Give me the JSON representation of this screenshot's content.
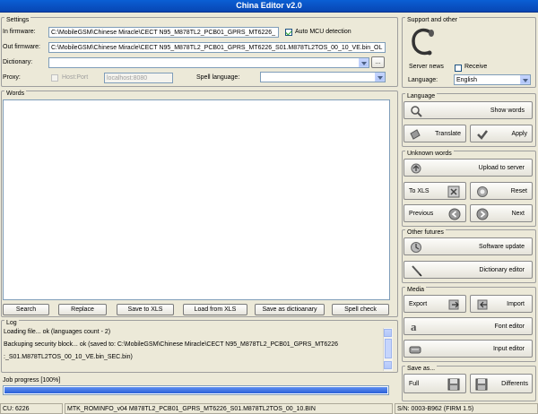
{
  "window": {
    "title": "China Editor v2.0"
  },
  "settings": {
    "group_label": "Settings",
    "in_label": "In firmware:",
    "in_value": "C:\\MobileGSM\\Chinese Miracle\\CECT N95_M878TL2_PCB01_GPRS_MT6226_",
    "auto_mcu_label": "Auto MCU detection",
    "auto_mcu_checked": true,
    "out_label": "Out firmware:",
    "out_value": "C:\\MobileGSM\\Chinese Miracle\\CECT N95_M878TL2_PCB01_GPRS_MT6226_S01.M878TL2TOS_00_10_VE.bin_OL",
    "dict_label": "Dictionary:",
    "dict_value": "",
    "browse_label": "...",
    "proxy_label": "Proxy:",
    "host_port_label": "Host:Port",
    "host_port_placeholder": "localhost:8080",
    "spell_label": "Spell language:",
    "spell_value": ""
  },
  "support": {
    "group_label": "Support and other",
    "server_news_label": "Server news",
    "receive_label": "Receive",
    "language_label": "Language:",
    "language_value": "English"
  },
  "words": {
    "group_label": "Words"
  },
  "word_buttons": [
    "Search",
    "Replace",
    "Save to XLS",
    "Load from XLS",
    "Save as dictioanary",
    "Spell check"
  ],
  "log": {
    "group_label": "Log",
    "lines": [
      "Loading file... ok (languages count - 2)",
      "Backuping security block... ok (saved to: C:\\MobileGSM\\Chinese Miracle\\CECT N95_M878TL2_PCB01_GPRS_MT6226",
      ":_S01.M878TL2TOS_00_10_VE.bin_SEC.bin)"
    ]
  },
  "progress": {
    "label": "Job progress [100%]",
    "value": 1.0
  },
  "status": {
    "cu": "CU: 6226",
    "info": "MTK_ROMINFO_v04 M878TL2_PCB01_GPRS_MT6226_S01.M878TL2TOS_00_10.BIN",
    "sn": "S/N: 0003-B962 (FIRM 1.5)"
  },
  "language_group": {
    "label": "Language",
    "show_words": "Show words",
    "translate": "Translate",
    "apply": "Apply"
  },
  "unknown": {
    "label": "Unknown words",
    "upload": "Upload to server",
    "to_xls": "To XLS",
    "reset": "Reset",
    "previous": "Previous",
    "next": "Next"
  },
  "other": {
    "label": "Other futures",
    "software_update": "Software update",
    "dictionary_editor": "Dictionary editor"
  },
  "media": {
    "label": "Media",
    "export": "Export",
    "import": "Import",
    "font_editor": "Font editor",
    "input_editor": "Input editor"
  },
  "save_as": {
    "label": "Save as...",
    "full": "Full",
    "differents": "Differents"
  },
  "colors": {
    "title_bar": "#0846b3",
    "progress": "#2b60d8",
    "window_bg": "#ece9d8"
  }
}
